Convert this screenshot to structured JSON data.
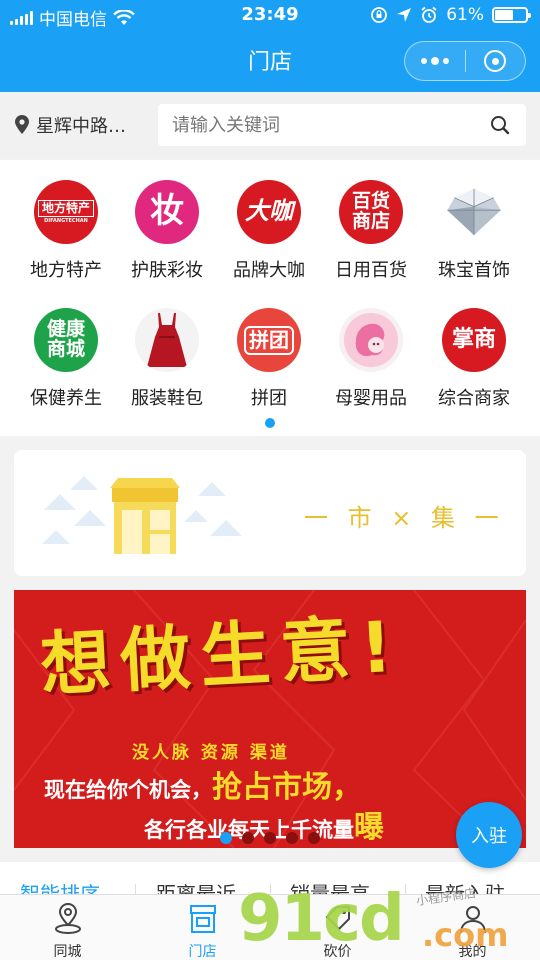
{
  "status_bar": {
    "carrier": "中国电信",
    "time": "23:49",
    "battery_percent": "61%",
    "battery_level": 0.61
  },
  "nav": {
    "title": "门店"
  },
  "search": {
    "location": "星辉中路…",
    "placeholder": "请输入关键词"
  },
  "categories": [
    {
      "label": "地方特产",
      "icon": "local-specialty-icon",
      "badge_top": "地方特产",
      "badge_bottom": "DIFANGTECHAN",
      "color": "#d71a21"
    },
    {
      "label": "护肤彩妆",
      "icon": "cosmetics-icon",
      "badge": "妆",
      "color": "#e0287f"
    },
    {
      "label": "品牌大咖",
      "icon": "brand-icon",
      "badge": "大咖",
      "color": "#d71a21"
    },
    {
      "label": "日用百货",
      "icon": "department-store-icon",
      "badge": "百货商店",
      "color": "#d71a21"
    },
    {
      "label": "珠宝首饰",
      "icon": "diamond-icon",
      "color": "#c9d2dc"
    },
    {
      "label": "保健养生",
      "icon": "health-icon",
      "badge": "健康商城",
      "color": "#1ea34a"
    },
    {
      "label": "服装鞋包",
      "icon": "dress-icon",
      "color": "#b51622"
    },
    {
      "label": "拼团",
      "icon": "group-buy-icon",
      "badge": "拼团",
      "color": "#e8453c"
    },
    {
      "label": "母婴用品",
      "icon": "mother-baby-icon",
      "color": "#ec6fa1"
    },
    {
      "label": "综合商家",
      "icon": "merchant-icon",
      "badge": "掌商",
      "color": "#d71a21"
    }
  ],
  "market": {
    "text": "一 市 × 集 一"
  },
  "banner": {
    "headline": "想做生意!",
    "line1": "没人脉 资源 渠道",
    "line2_prefix": "现在给你个机会，",
    "line2_highlight": "抢占市场，",
    "line3_prefix": "各行各业每天上千流量",
    "line3_highlight": "曝",
    "slides_total": 5,
    "active_slide": 1
  },
  "join_button": "入驻",
  "filter_tabs": [
    "智能排序",
    "距离最近",
    "销量最高",
    "最新入驻"
  ],
  "tabbar": [
    {
      "label": "同城",
      "icon": "location-pin-icon",
      "active": false
    },
    {
      "label": "门店",
      "icon": "store-icon",
      "active": true
    },
    {
      "label": "砍价",
      "icon": "bargain-icon",
      "active": false
    },
    {
      "label": "我的",
      "icon": "user-icon",
      "active": false
    }
  ],
  "watermark": {
    "big": "91cd",
    "com": ".com",
    "small": "小程序商店"
  },
  "colors": {
    "primary": "#1aa0f5",
    "banner_red": "#d31c1c",
    "banner_yellow": "#f6dc2a"
  }
}
